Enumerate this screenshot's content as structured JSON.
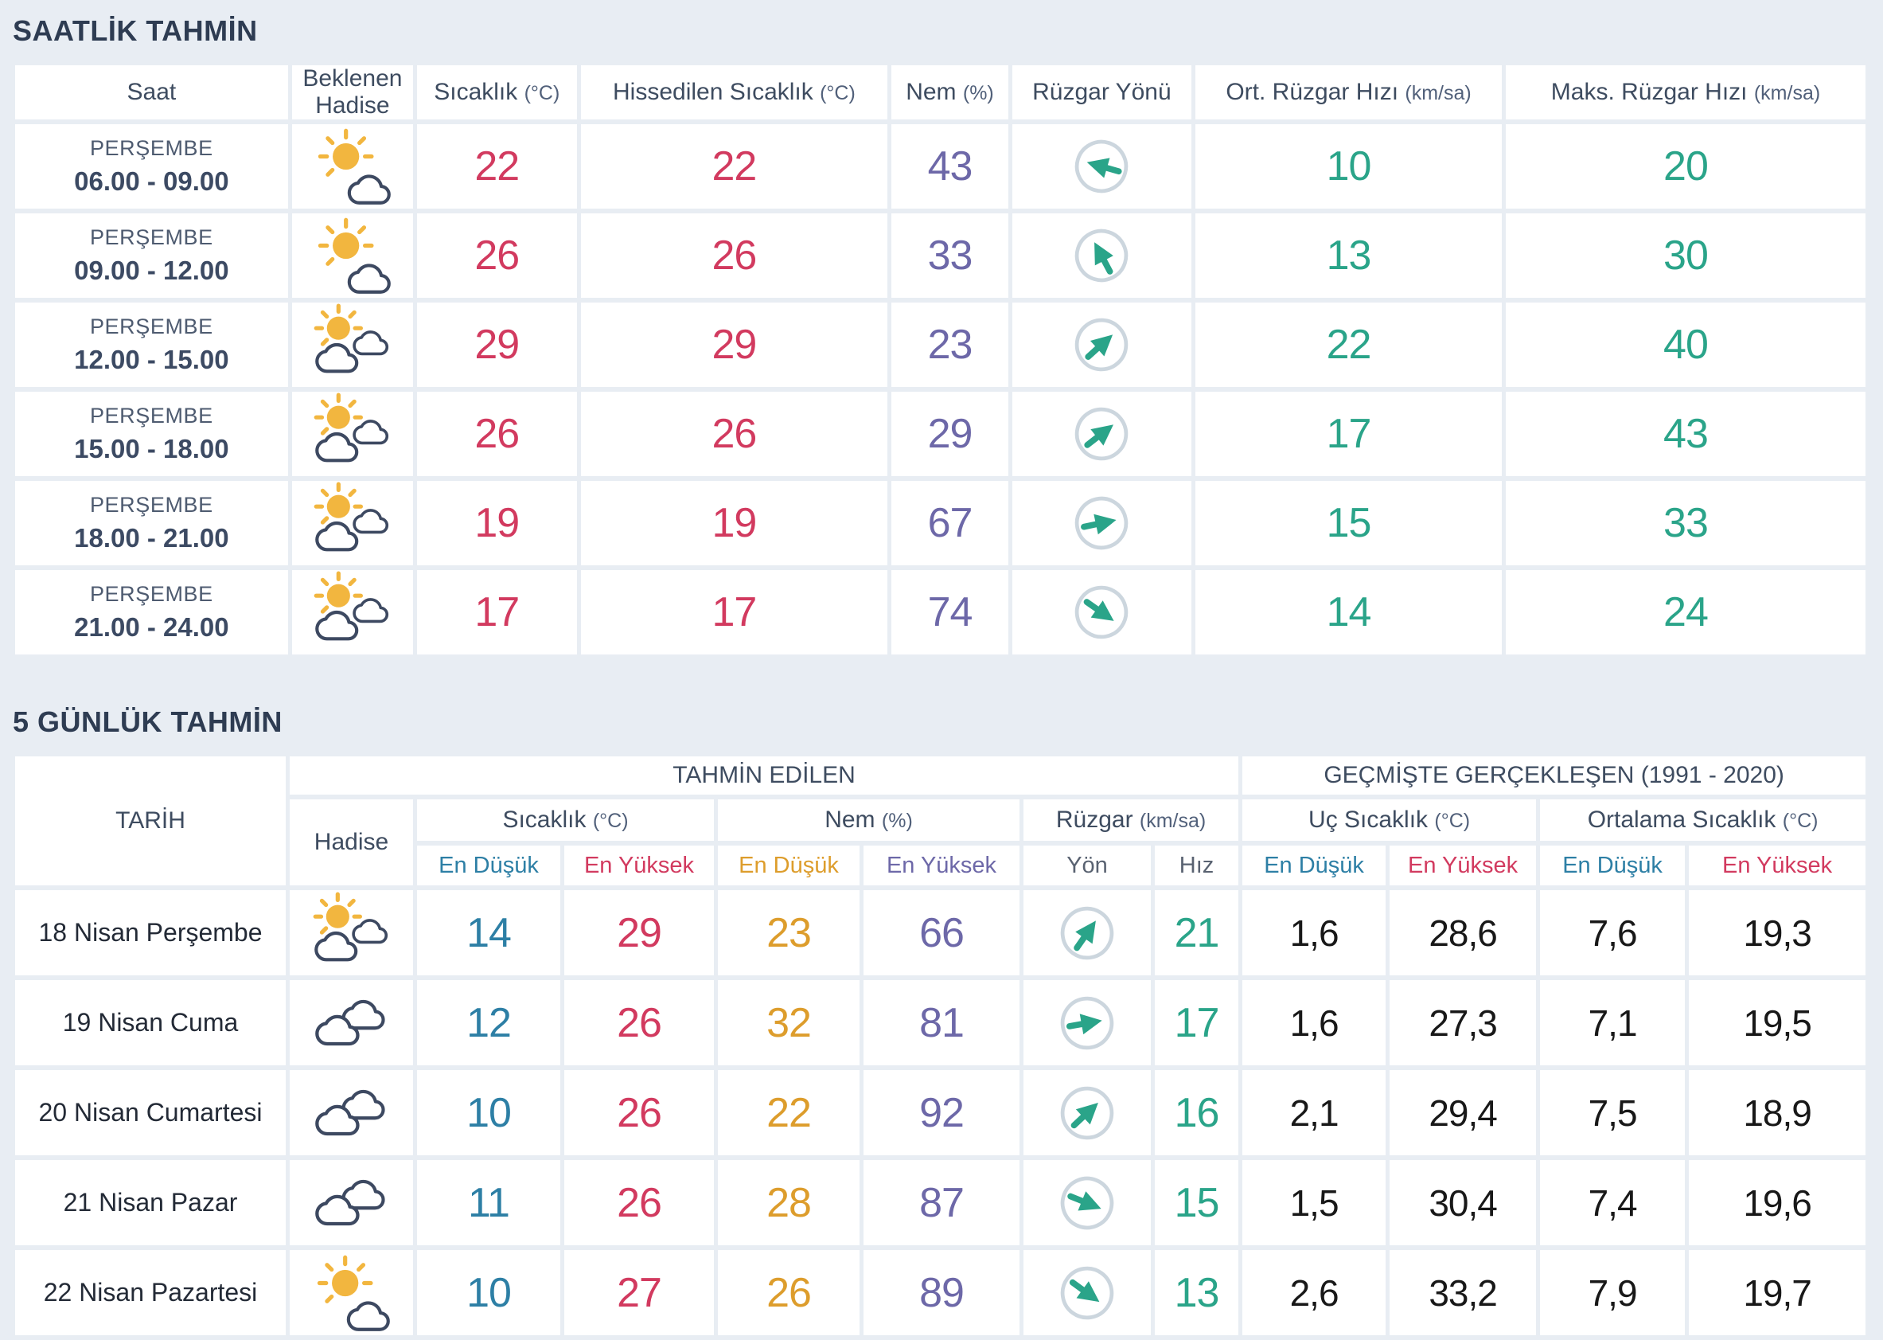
{
  "hourly": {
    "title": "SAATLİK TAHMİN",
    "columns": [
      {
        "label": "Saat",
        "unit": ""
      },
      {
        "label": "Beklenen Hadise",
        "unit": ""
      },
      {
        "label": "Sıcaklık",
        "unit": "(°C)"
      },
      {
        "label": "Hissedilen Sıcaklık",
        "unit": "(°C)"
      },
      {
        "label": "Nem",
        "unit": "(%)"
      },
      {
        "label": "Rüzgar Yönü",
        "unit": ""
      },
      {
        "label": "Ort. Rüzgar Hızı",
        "unit": "(km/sa)"
      },
      {
        "label": "Maks. Rüzgar Hızı",
        "unit": "(km/sa)"
      }
    ],
    "rows": [
      {
        "day": "PERŞEMBE",
        "time": "06.00 - 09.00",
        "icon": "sun-small-cloud",
        "temp": "22",
        "feels_like": "22",
        "humidity": "43",
        "wind_rotation_deg": 196,
        "wind_avg": "10",
        "wind_max": "20"
      },
      {
        "day": "PERŞEMBE",
        "time": "09.00 - 12.00",
        "icon": "sun-small-cloud",
        "temp": "26",
        "feels_like": "26",
        "humidity": "33",
        "wind_rotation_deg": -118,
        "wind_avg": "13",
        "wind_max": "30"
      },
      {
        "day": "PERŞEMBE",
        "time": "12.00 - 15.00",
        "icon": "sun-clouds",
        "temp": "29",
        "feels_like": "29",
        "humidity": "23",
        "wind_rotation_deg": -42,
        "wind_avg": "22",
        "wind_max": "40"
      },
      {
        "day": "PERŞEMBE",
        "time": "15.00 - 18.00",
        "icon": "sun-clouds",
        "temp": "26",
        "feels_like": "26",
        "humidity": "29",
        "wind_rotation_deg": -38,
        "wind_avg": "17",
        "wind_max": "43"
      },
      {
        "day": "PERŞEMBE",
        "time": "18.00 - 21.00",
        "icon": "sun-clouds",
        "temp": "19",
        "feels_like": "19",
        "humidity": "67",
        "wind_rotation_deg": -12,
        "wind_avg": "15",
        "wind_max": "33"
      },
      {
        "day": "PERŞEMBE",
        "time": "21.00 - 24.00",
        "icon": "sun-clouds",
        "temp": "17",
        "feels_like": "17",
        "humidity": "74",
        "wind_rotation_deg": 35,
        "wind_avg": "14",
        "wind_max": "24"
      }
    ]
  },
  "daily": {
    "title": "5 GÜNLÜK TAHMİN",
    "tarih_label": "TARİH",
    "forecast_group_label": "TAHMİN EDİLEN",
    "past_group_label": "GEÇMİŞTE GERÇEKLEŞEN (1991 - 2020)",
    "hadise_label": "Hadise",
    "groups": {
      "temp": {
        "label": "Sıcaklık",
        "unit": "(°C)"
      },
      "humidity": {
        "label": "Nem",
        "unit": "(%)"
      },
      "wind": {
        "label": "Rüzgar",
        "unit": "(km/sa)"
      },
      "extreme_temp": {
        "label": "Uç Sıcaklık",
        "unit": "(°C)"
      },
      "avg_temp": {
        "label": "Ortalama Sıcaklık",
        "unit": "(°C)"
      }
    },
    "sub": {
      "low": "En Düşük",
      "high": "En Yüksek",
      "direction": "Yön",
      "speed": "Hız"
    },
    "rows": [
      {
        "date": "18 Nisan Perşembe",
        "icon": "sun-clouds",
        "temp_low": "14",
        "temp_high": "29",
        "hum_low": "23",
        "hum_high": "66",
        "wind_rotation_deg": -55,
        "wind_speed": "21",
        "ext_low": "1,6",
        "ext_high": "28,6",
        "avg_low": "7,6",
        "avg_high": "19,3"
      },
      {
        "date": "19 Nisan Cuma",
        "icon": "clouds",
        "temp_low": "12",
        "temp_high": "26",
        "hum_low": "32",
        "hum_high": "81",
        "wind_rotation_deg": -10,
        "wind_speed": "17",
        "ext_low": "1,6",
        "ext_high": "27,3",
        "avg_low": "7,1",
        "avg_high": "19,5"
      },
      {
        "date": "20 Nisan Cumartesi",
        "icon": "clouds",
        "temp_low": "10",
        "temp_high": "26",
        "hum_low": "22",
        "hum_high": "92",
        "wind_rotation_deg": -43,
        "wind_speed": "16",
        "ext_low": "2,1",
        "ext_high": "29,4",
        "avg_low": "7,5",
        "avg_high": "18,9"
      },
      {
        "date": "21 Nisan Pazar",
        "icon": "clouds",
        "temp_low": "11",
        "temp_high": "26",
        "hum_low": "28",
        "hum_high": "87",
        "wind_rotation_deg": 22,
        "wind_speed": "15",
        "ext_low": "1,5",
        "ext_high": "30,4",
        "avg_low": "7,4",
        "avg_high": "19,6"
      },
      {
        "date": "22 Nisan Pazartesi",
        "icon": "sun-small-cloud",
        "temp_low": "10",
        "temp_high": "27",
        "hum_low": "26",
        "hum_high": "89",
        "wind_rotation_deg": 36,
        "wind_speed": "13",
        "ext_low": "2,6",
        "ext_high": "33,2",
        "avg_low": "7,9",
        "avg_high": "19,7"
      }
    ]
  },
  "colors": {
    "temperature_red": "#d23a5f",
    "humidity_purple": "#6d68a8",
    "wind_teal": "#2aa489",
    "low_blue": "#2d7fa5",
    "humidity_low_orange": "#dd9d2c",
    "background": "#e8edf3",
    "sun_yellow": "#f2b63f",
    "cloud_outline": "#3d4961"
  }
}
